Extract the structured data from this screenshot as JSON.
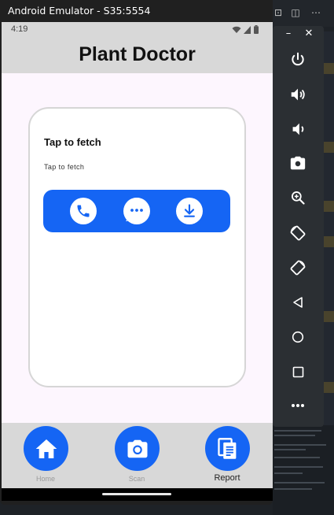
{
  "window": {
    "title": "Android Emulator - S35:5554"
  },
  "status_bar": {
    "time": "4:19"
  },
  "app": {
    "title": "Plant Doctor"
  },
  "card": {
    "title": "Tap to fetch",
    "subtitle": "Tap to fetch",
    "actions": [
      {
        "icon": "phone-icon"
      },
      {
        "icon": "message-icon"
      },
      {
        "icon": "download-icon"
      }
    ]
  },
  "bottom_nav": {
    "items": [
      {
        "label": "Home",
        "icon": "home-icon",
        "active": false
      },
      {
        "label": "Scan",
        "icon": "camera-icon",
        "active": false
      },
      {
        "label": "Report",
        "icon": "report-icon",
        "active": true
      }
    ]
  },
  "side_toolbar": {
    "controls": [
      "minimize",
      "close",
      "power",
      "volume-up",
      "volume-down",
      "screenshot",
      "zoom",
      "rotate-left",
      "rotate-right",
      "back",
      "home",
      "overview",
      "more"
    ]
  },
  "colors": {
    "accent": "#1565f4",
    "app_bar": "#d8d8d8",
    "content_bg": "#fdf6fe",
    "toolbar_bg": "#2b2f33"
  }
}
